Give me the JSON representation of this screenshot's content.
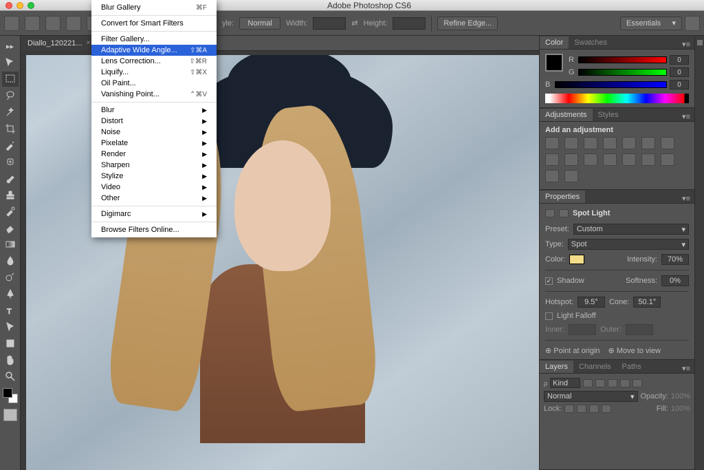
{
  "titlebar": {
    "app": "Adobe Photoshop CS6"
  },
  "optbar": {
    "style_label": "yle:",
    "style_value": "Normal",
    "width_label": "Width:",
    "height_label": "Height:",
    "refine": "Refine Edge...",
    "workspace": "Essentials"
  },
  "doc": {
    "tab": "Diallo_120221..."
  },
  "filter_menu": {
    "top_items": [
      {
        "label": "Blur Gallery",
        "shortcut": "⌘F"
      }
    ],
    "smart": "Convert for Smart Filters",
    "group2": [
      {
        "label": "Filter Gallery..."
      },
      {
        "label": "Adaptive Wide Angle...",
        "shortcut": "⇧⌘A",
        "hl": true
      },
      {
        "label": "Lens Correction...",
        "shortcut": "⇧⌘R"
      },
      {
        "label": "Liquify...",
        "shortcut": "⇧⌘X"
      },
      {
        "label": "Oil Paint..."
      },
      {
        "label": "Vanishing Point...",
        "shortcut": "⌃⌘V"
      }
    ],
    "submenus": [
      "Blur",
      "Distort",
      "Noise",
      "Pixelate",
      "Render",
      "Sharpen",
      "Stylize",
      "Video",
      "Other"
    ],
    "digimarc": "Digimarc",
    "browse": "Browse Filters Online..."
  },
  "panels": {
    "color": {
      "tab1": "Color",
      "tab2": "Swatches",
      "r": "0",
      "g": "0",
      "b": "0"
    },
    "adjustments": {
      "tab1": "Adjustments",
      "tab2": "Styles",
      "heading": "Add an adjustment"
    },
    "properties": {
      "tab": "Properties",
      "title": "Spot Light",
      "preset_label": "Preset:",
      "preset_value": "Custom",
      "type_label": "Type:",
      "type_value": "Spot",
      "color_label": "Color:",
      "intensity_label": "Intensity:",
      "intensity_value": "70%",
      "shadow_label": "Shadow",
      "softness_label": "Softness:",
      "softness_value": "0%",
      "hotspot_label": "Hotspot:",
      "hotspot_value": "9.5°",
      "cone_label": "Cone:",
      "cone_value": "50.1°",
      "falloff_label": "Light Falloff",
      "inner_label": "Inner:",
      "inner_value": "",
      "outer_label": "Outer:",
      "outer_value": "",
      "point": "Point at origin",
      "move": "Move to view"
    },
    "layers": {
      "tab1": "Layers",
      "tab2": "Channels",
      "tab3": "Paths",
      "kind": "Kind",
      "blend": "Normal",
      "opacity_label": "Opacity:",
      "opacity_value": "100%",
      "lock_label": "Lock:",
      "fill_label": "Fill:",
      "fill_value": "100%"
    }
  }
}
